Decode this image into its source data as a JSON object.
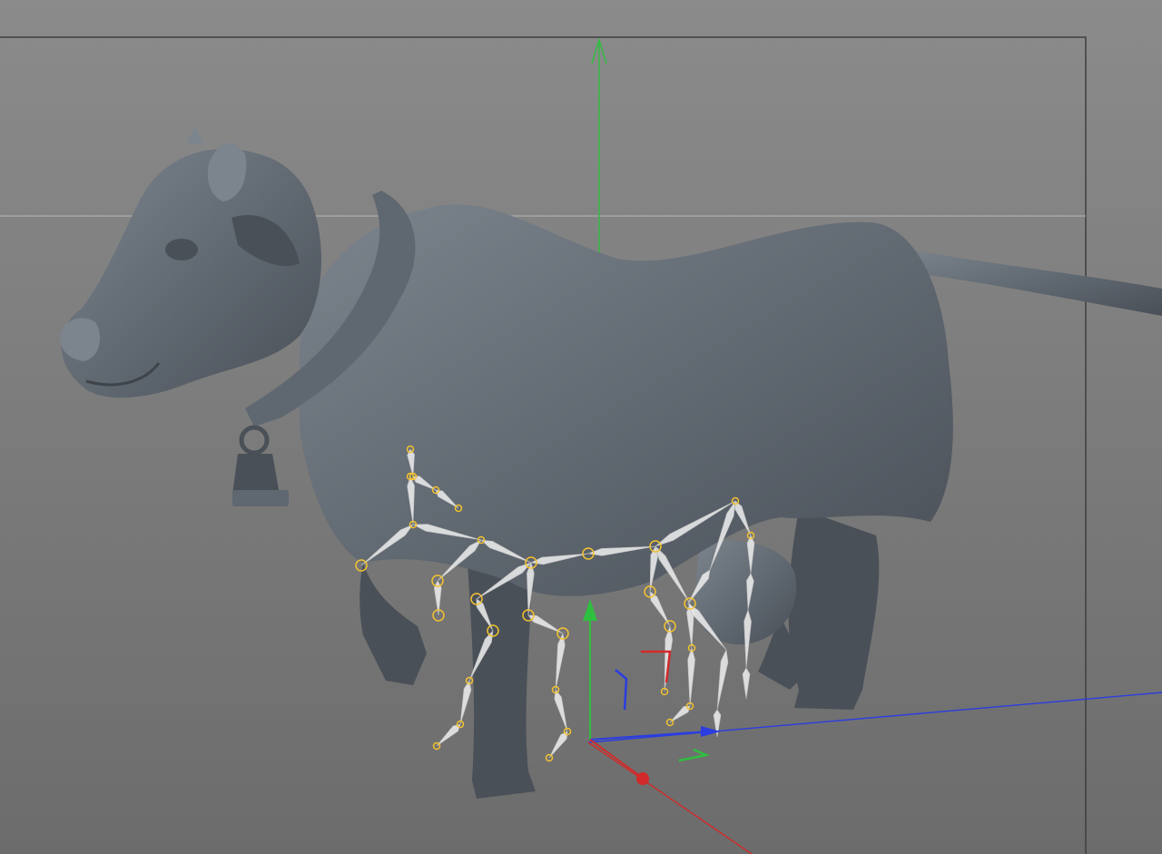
{
  "viewport": {
    "background_top": "#8b8b8b",
    "background_bottom": "#6c6c6c",
    "model_color": "#5f6770",
    "model_shadow": "#4a5058",
    "model_highlight": "#7c848d",
    "frame_color": "#3e3e3e",
    "horizon_color": "#b7b7b7"
  },
  "axes": {
    "y_color": "#2fbf3f",
    "x_color": "#d22a2a",
    "z_color": "#2b3de0"
  },
  "rig": {
    "bone_color": "#f0f0f0",
    "joint_color": "#f2c230",
    "joint_count": 32
  },
  "icons": {
    "model": "cow-model-icon",
    "gizmo": "move-gizmo-icon"
  }
}
